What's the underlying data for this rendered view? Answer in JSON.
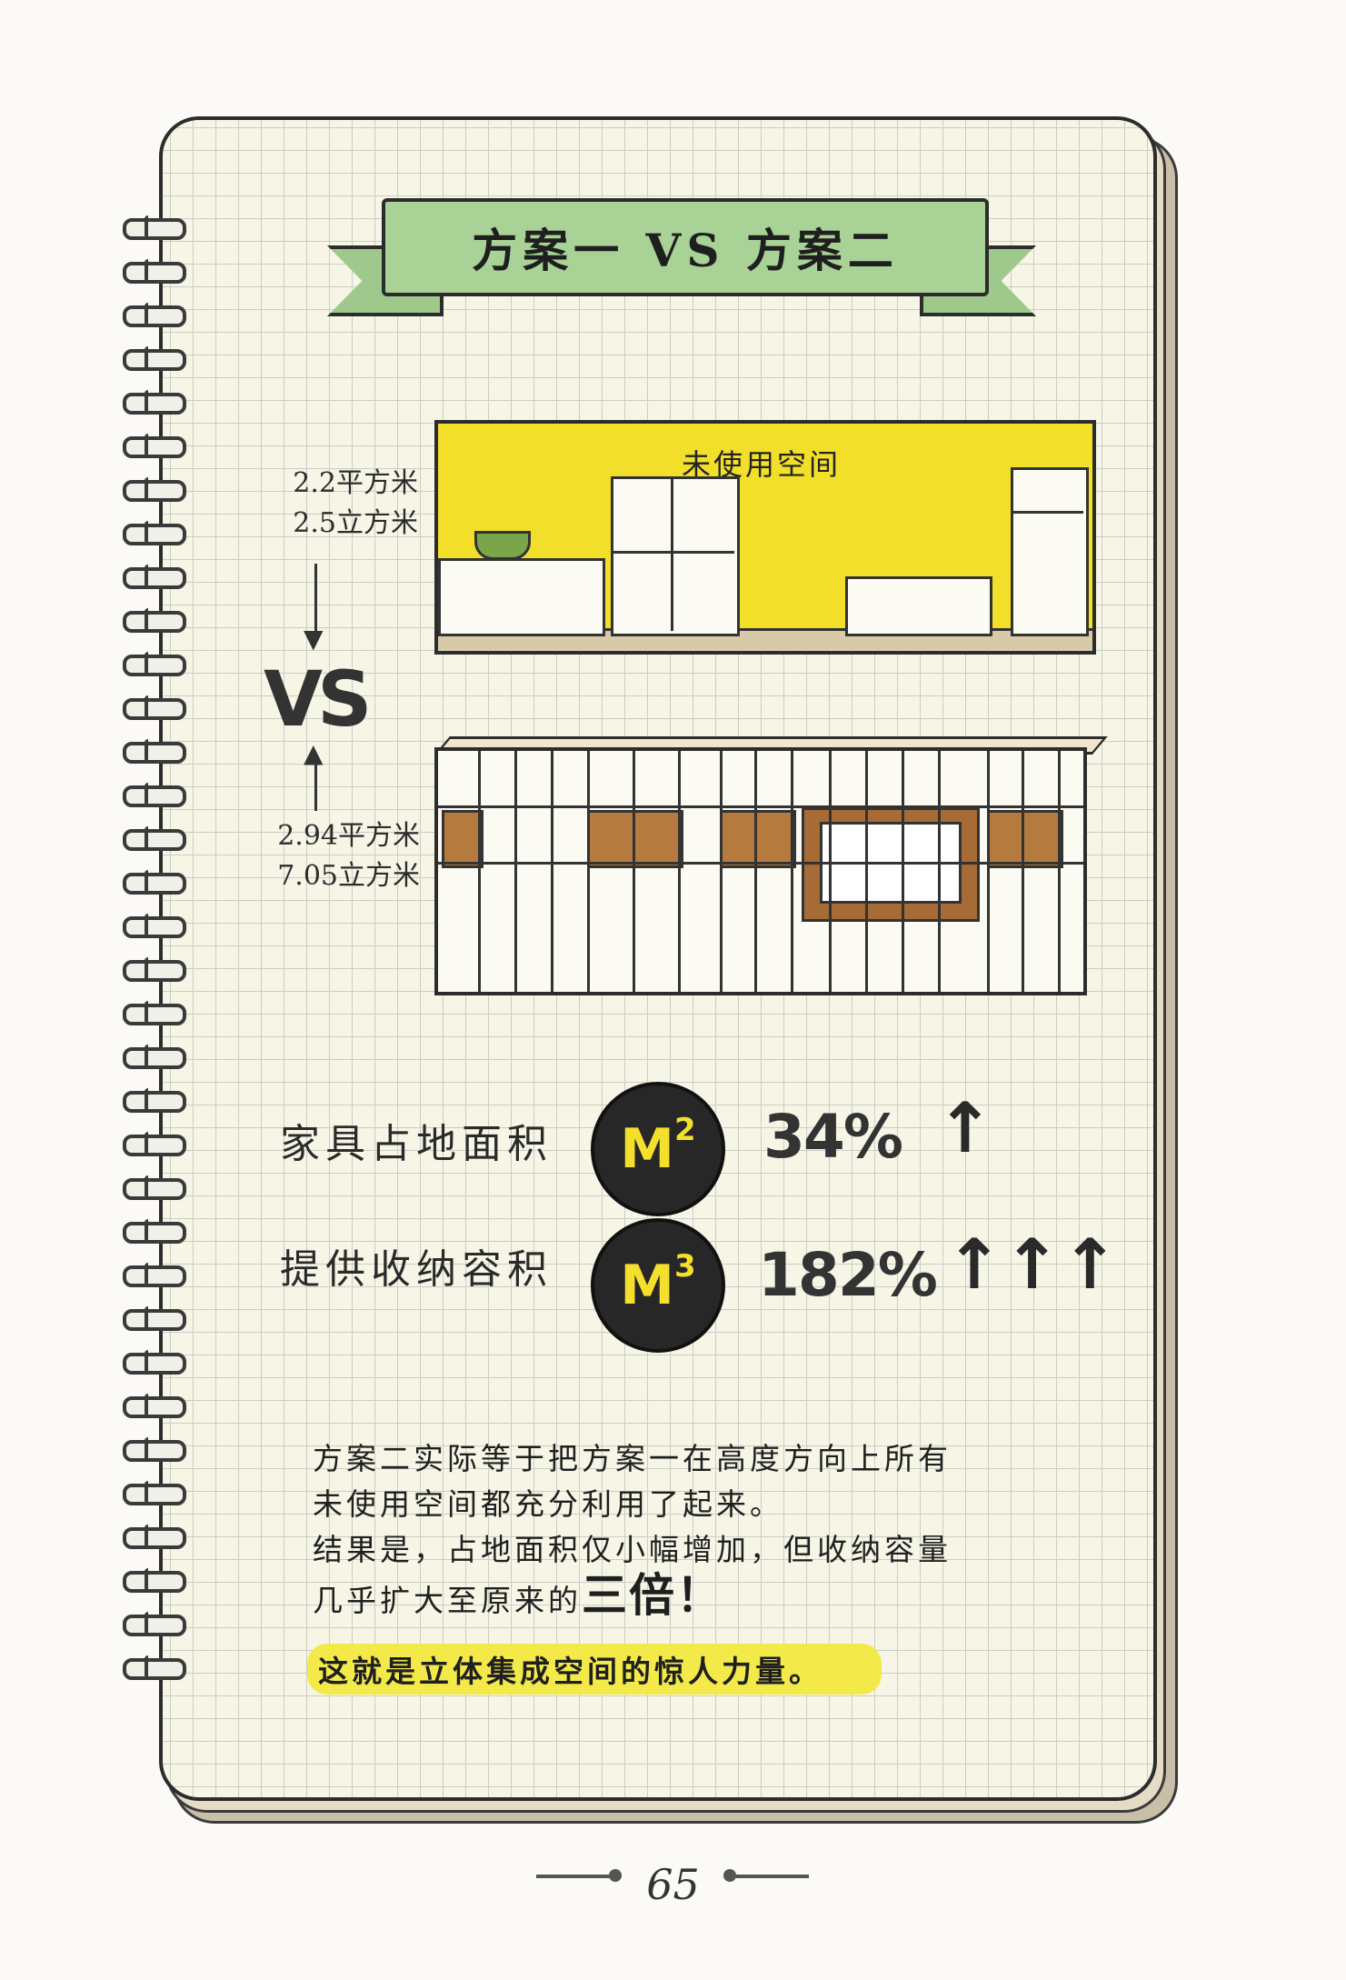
{
  "title": "方案一 VS 方案二",
  "scheme_one": {
    "area": "2.2平方米",
    "volume": "2.5立方米",
    "wall_label": "未使用空间"
  },
  "vs_label": "VS",
  "scheme_two": {
    "area": "2.94平方米",
    "volume": "7.05立方米"
  },
  "stats": {
    "floor": {
      "label": "家具占地面积",
      "badge": "M",
      "badge_sup": "2",
      "percent": "34%",
      "arrows": "↑"
    },
    "storage": {
      "label": "提供收纳容积",
      "badge": "M",
      "badge_sup": "3",
      "percent": "182%",
      "arrows": "↑↑↑"
    }
  },
  "paragraph": {
    "line1": "方案二实际等于把方案一在高度方向上所有",
    "line2": "未使用空间都充分利用了起来。",
    "line3": "结果是，占地面积仅小幅增加，但收纳容量",
    "line4_prefix": "几乎扩大至原来的",
    "line4_emph": "三倍！"
  },
  "highlight": "这就是立体集成空间的惊人力量。",
  "page_number": "65",
  "colors": {
    "banner": "#a9d296",
    "wall_yellow": "#f2df2a",
    "badge_bg": "#272727",
    "badge_text": "#f4df2c",
    "highlight": "#f3ea4a",
    "wood": "#b57a3e"
  }
}
